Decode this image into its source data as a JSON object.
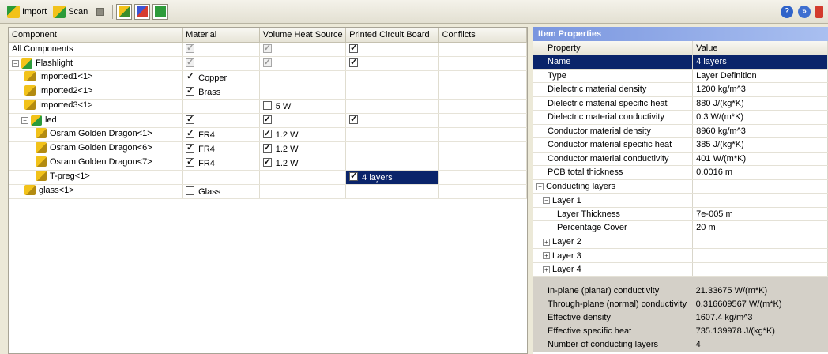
{
  "toolbar": {
    "import_label": "Import",
    "scan_label": "Scan"
  },
  "tree": {
    "headers": [
      "Component",
      "Material",
      "Volume Heat Source",
      "Printed Circuit Board",
      "Conflicts"
    ],
    "rows": [
      {
        "component": "All Components",
        "material": "",
        "vhs": "",
        "pcb": ""
      },
      {
        "component": "Flashlight",
        "material": "",
        "vhs": "",
        "pcb": ""
      },
      {
        "component": "Imported1<1>",
        "material": "Copper",
        "vhs": "",
        "pcb": ""
      },
      {
        "component": "Imported2<1>",
        "material": "Brass",
        "vhs": "",
        "pcb": ""
      },
      {
        "component": "Imported3<1>",
        "material": "",
        "vhs": "5 W",
        "pcb": ""
      },
      {
        "component": "led",
        "material": "",
        "vhs": "",
        "pcb": ""
      },
      {
        "component": "Osram Golden Dragon<1>",
        "material": "FR4",
        "vhs": "1.2 W",
        "pcb": ""
      },
      {
        "component": "Osram Golden Dragon<6>",
        "material": "FR4",
        "vhs": "1.2 W",
        "pcb": ""
      },
      {
        "component": "Osram Golden Dragon<7>",
        "material": "FR4",
        "vhs": "1.2 W",
        "pcb": ""
      },
      {
        "component": "T-preg<1>",
        "material": "",
        "vhs": "",
        "pcb": "4 layers"
      },
      {
        "component": "glass<1>",
        "material": "Glass",
        "vhs": "",
        "pcb": ""
      }
    ]
  },
  "properties": {
    "title": "Item Properties",
    "header_property": "Property",
    "header_value": "Value",
    "rows": [
      {
        "key": "Name",
        "value": "4 layers"
      },
      {
        "key": "Type",
        "value": "Layer Definition"
      },
      {
        "key": "Dielectric material density",
        "value": "1200 kg/m^3"
      },
      {
        "key": "Dielectric material specific heat",
        "value": "880 J/(kg*K)"
      },
      {
        "key": "Dielectric material conductivity",
        "value": "0.3 W/(m*K)"
      },
      {
        "key": "Conductor material density",
        "value": "8960 kg/m^3"
      },
      {
        "key": "Conductor material specific heat",
        "value": "385 J/(kg*K)"
      },
      {
        "key": "Conductor material conductivity",
        "value": "401 W/(m*K)"
      },
      {
        "key": "PCB total thickness",
        "value": "0.0016 m"
      },
      {
        "key": "Conducting layers",
        "value": ""
      },
      {
        "key": "Layer 1",
        "value": ""
      },
      {
        "key": "Layer Thickness",
        "value": "7e-005 m"
      },
      {
        "key": "Percentage Cover",
        "value": "20 m"
      },
      {
        "key": "Layer 2",
        "value": ""
      },
      {
        "key": "Layer 3",
        "value": ""
      },
      {
        "key": "Layer 4",
        "value": ""
      }
    ],
    "summary": [
      {
        "key": "In-plane (planar) conductivity",
        "value": "21.33675 W/(m*K)"
      },
      {
        "key": "Through-plane (normal) conductivity",
        "value": "0.316609567 W/(m*K)"
      },
      {
        "key": "Effective density",
        "value": "1607.4 kg/m^3"
      },
      {
        "key": "Effective specific heat",
        "value": "735.139978 J/(kg*K)"
      },
      {
        "key": "Number of conducting layers",
        "value": "4"
      }
    ]
  },
  "icons": {
    "help": "help-icon",
    "minimize": "collapse-icon",
    "close": "close-icon"
  },
  "colors": {
    "selection": "#0a246a",
    "panel_title": "#7a96df"
  }
}
